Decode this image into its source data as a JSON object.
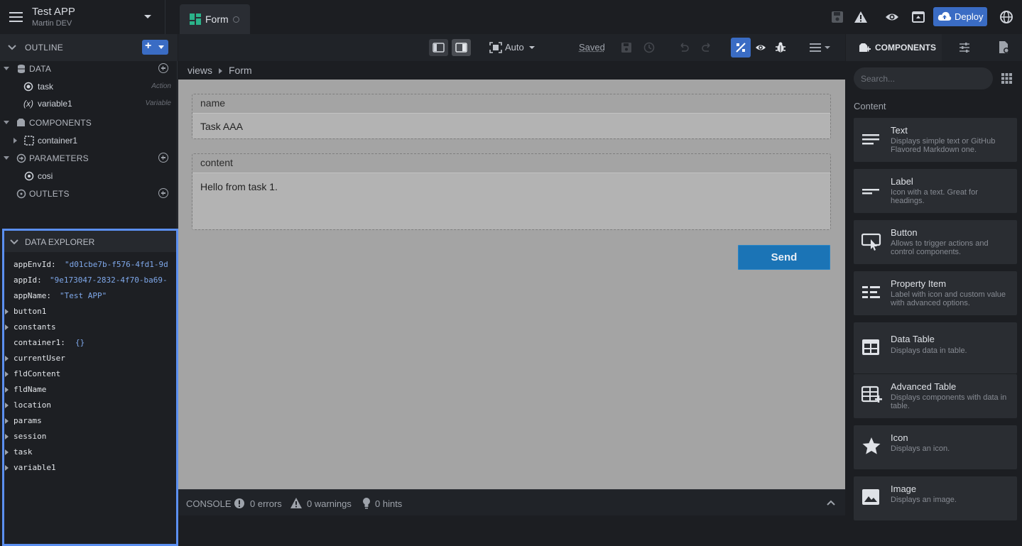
{
  "app": {
    "title": "Test APP",
    "subtitle": "Martin DEV"
  },
  "tabs": [
    {
      "label": "Form"
    }
  ],
  "topbar": {
    "deploy_label": "Deploy"
  },
  "outline": {
    "header": "OUTLINE",
    "add_label": "+",
    "sections": {
      "data": "DATA",
      "components": "COMPONENTS",
      "parameters": "PARAMETERS",
      "outlets": "OUTLETS"
    },
    "data_items": [
      {
        "label": "task",
        "kind": "Action"
      },
      {
        "label": "variable1",
        "kind": "Variable",
        "prefix": "(x)"
      }
    ],
    "component_items": [
      {
        "label": "container1"
      }
    ],
    "parameter_items": [
      {
        "label": "cosi"
      }
    ]
  },
  "data_explorer": {
    "header": "DATA EXPLORER",
    "rows": [
      {
        "key": "appEnvId:",
        "value": "\"d01cbe7b-f576-4fd1-9d"
      },
      {
        "key": "appId:",
        "value": "\"9e173047-2832-4f70-ba69-"
      },
      {
        "key": "appName:",
        "value": "\"Test APP\""
      },
      {
        "key": "button1",
        "value": ""
      },
      {
        "key": "constants",
        "value": ""
      },
      {
        "key": "container1:",
        "value": "{}"
      },
      {
        "key": "currentUser",
        "value": ""
      },
      {
        "key": "fldContent",
        "value": ""
      },
      {
        "key": "fldName",
        "value": ""
      },
      {
        "key": "location",
        "value": ""
      },
      {
        "key": "params",
        "value": ""
      },
      {
        "key": "session",
        "value": ""
      },
      {
        "key": "task",
        "value": ""
      },
      {
        "key": "variable1",
        "value": ""
      }
    ]
  },
  "toolbar": {
    "zoom_label": "Auto",
    "saved_label": "Saved"
  },
  "breadcrumb": {
    "root": "views",
    "current": "Form"
  },
  "form": {
    "name_label": "name",
    "name_value": "Task AAA",
    "content_label": "content",
    "content_value": "Hello from task 1.",
    "send_label": "Send"
  },
  "console": {
    "label": "CONSOLE",
    "errors": "0 errors",
    "warnings": "0 warnings",
    "hints": "0 hints"
  },
  "right_panel": {
    "tab_label": "COMPONENTS",
    "search_placeholder": "Search...",
    "section_label": "Content",
    "components": [
      {
        "name": "Text",
        "desc": "Displays simple text or GitHub Flavored Markdown one.",
        "icon": "text-lines-icon"
      },
      {
        "name": "Label",
        "desc": "Icon with a text. Great for headings.",
        "icon": "label-icon"
      },
      {
        "name": "Button",
        "desc": "Allows to trigger actions and control components.",
        "icon": "button-click-icon"
      },
      {
        "name": "Property Item",
        "desc": "Label with icon and custom value with advanced options.",
        "icon": "property-list-icon"
      },
      {
        "name": "Data Table",
        "desc": "Displays data in table.",
        "icon": "table-icon"
      },
      {
        "name": "Advanced Table",
        "desc": "Displays components with data in table.",
        "icon": "table-add-icon"
      },
      {
        "name": "Icon",
        "desc": "Displays an icon.",
        "icon": "star-icon"
      },
      {
        "name": "Image",
        "desc": "Displays an image.",
        "icon": "image-icon"
      }
    ]
  }
}
